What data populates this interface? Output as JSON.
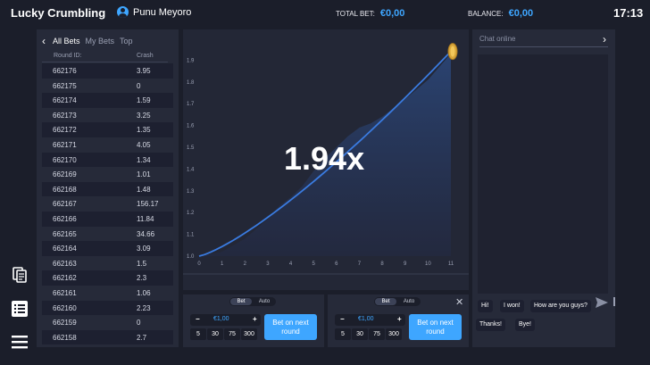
{
  "header": {
    "app_title": "Lucky Crumbling",
    "user_name": "Punu Meyoro",
    "total_bet_label": "TOTAL BET:",
    "total_bet_value": "€0,00",
    "balance_label": "BALANCE:",
    "balance_value": "€0,00",
    "clock": "17:13"
  },
  "sidebar": {
    "icons": [
      "document-icon",
      "list-icon",
      "menu-icon"
    ]
  },
  "bets": {
    "tabs": [
      "All Bets",
      "My Bets",
      "Top"
    ],
    "active_tab": "All Bets",
    "col_round": "Round ID:",
    "col_crash": "Crash",
    "rows": [
      {
        "round": "662176",
        "crash": "3.95"
      },
      {
        "round": "662175",
        "crash": "0"
      },
      {
        "round": "662174",
        "crash": "1.59"
      },
      {
        "round": "662173",
        "crash": "3.25"
      },
      {
        "round": "662172",
        "crash": "1.35"
      },
      {
        "round": "662171",
        "crash": "4.05"
      },
      {
        "round": "662170",
        "crash": "1.34"
      },
      {
        "round": "662169",
        "crash": "1.01"
      },
      {
        "round": "662168",
        "crash": "1.48"
      },
      {
        "round": "662167",
        "crash": "156.17"
      },
      {
        "round": "662166",
        "crash": "11.84"
      },
      {
        "round": "662165",
        "crash": "34.66"
      },
      {
        "round": "662164",
        "crash": "3.09"
      },
      {
        "round": "662163",
        "crash": "1.5"
      },
      {
        "round": "662162",
        "crash": "2.3"
      },
      {
        "round": "662161",
        "crash": "1.06"
      },
      {
        "round": "662160",
        "crash": "2.23"
      },
      {
        "round": "662159",
        "crash": "0"
      },
      {
        "round": "662158",
        "crash": "2.7"
      }
    ]
  },
  "game": {
    "multiplier": "1.94x",
    "y_ticks": [
      "1.0",
      "1.1",
      "1.2",
      "1.3",
      "1.4",
      "1.5",
      "1.6",
      "1.7",
      "1.8",
      "1.9"
    ],
    "x_ticks": [
      "0",
      "1",
      "2",
      "3",
      "4",
      "5",
      "6",
      "7",
      "8",
      "9",
      "10",
      "11"
    ],
    "curve_color": "#3a7be0"
  },
  "bet_panels": [
    {
      "mode_bet": "Bet",
      "mode_auto": "Auto",
      "amount": "€1,00",
      "quick": [
        "5",
        "30",
        "75",
        "300"
      ],
      "button": "Bet on next round"
    },
    {
      "mode_bet": "Bet",
      "mode_auto": "Auto",
      "amount": "€1,00",
      "quick": [
        "5",
        "30",
        "75",
        "300"
      ],
      "button": "Bet on next round"
    }
  ],
  "chat": {
    "placeholder": "Chat online",
    "quick_messages": [
      "Hi!",
      "I won!",
      "How are you guys?",
      "Thanks!",
      "Bye!"
    ]
  },
  "colors": {
    "accent": "#3ea6ff",
    "background": "#1b1e2a",
    "panel": "#262a39"
  }
}
